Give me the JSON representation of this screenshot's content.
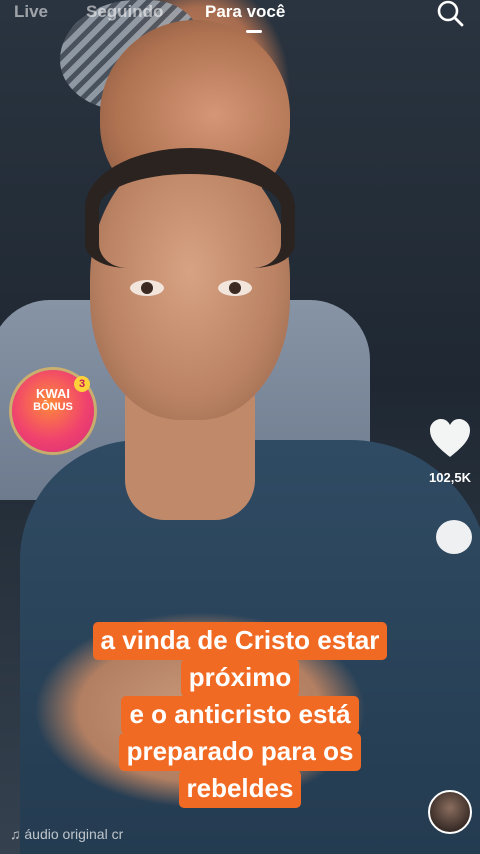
{
  "nav": {
    "tabs": [
      {
        "label": "Live",
        "active": false
      },
      {
        "label": "Seguindo",
        "active": false
      },
      {
        "label": "Para você",
        "active": true
      }
    ],
    "search_icon": "search-icon"
  },
  "bonus": {
    "brand": "KWAI",
    "label": "BÔNUS",
    "badge": "3"
  },
  "actions": {
    "like_icon": "heart-icon",
    "like_count": "102,5K",
    "comment_icon": "comment-icon"
  },
  "caption": {
    "lines": [
      "a vinda de Cristo estar",
      "próximo",
      "e o anticristo está",
      "preparado para os",
      "rebeldes"
    ],
    "background_color": "#f16a23"
  },
  "audio": {
    "icon": "music-note-icon",
    "text": "áudio original cr"
  }
}
